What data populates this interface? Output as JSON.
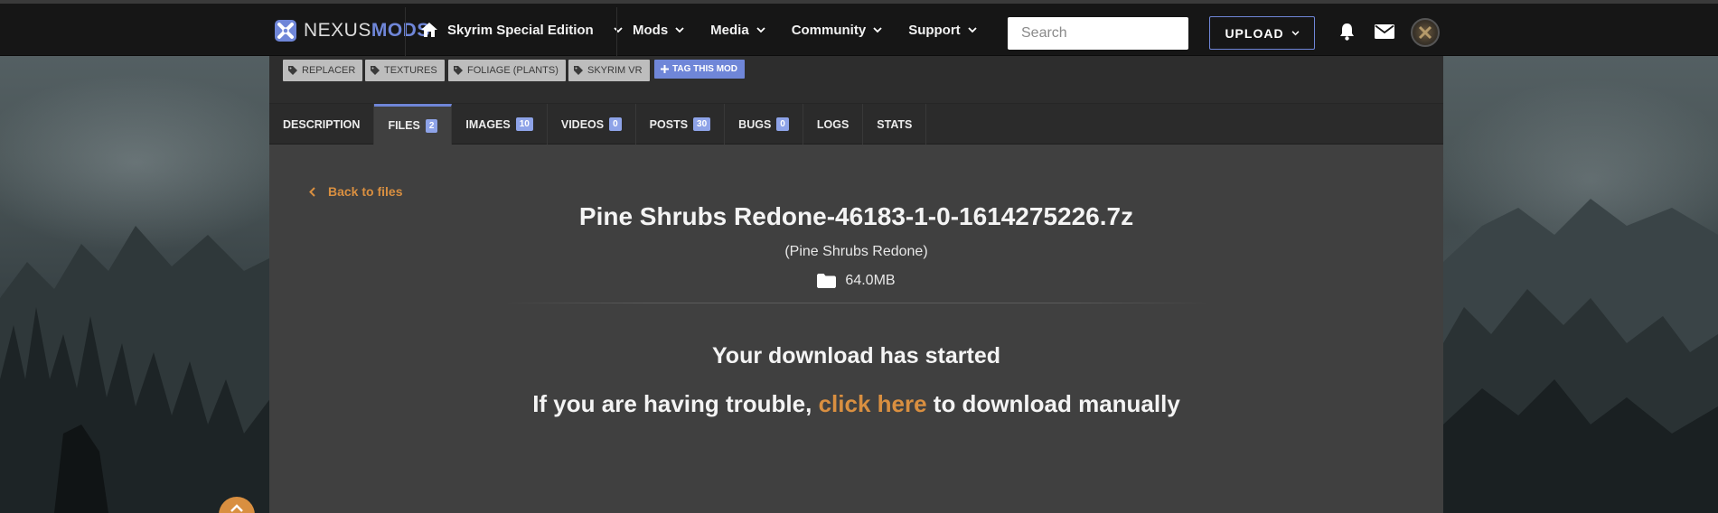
{
  "brand": {
    "logo_prefix": "NEXUS",
    "logo_suffix": "MODS"
  },
  "header": {
    "game_label": "Skyrim Special Edition",
    "menu": [
      "Mods",
      "Media",
      "Community",
      "Support"
    ],
    "search_placeholder": "Search",
    "upload_label": "UPLOAD"
  },
  "tags": [
    "REPLACER",
    "TEXTURES",
    "FOLIAGE (PLANTS)",
    "SKYRIM VR"
  ],
  "tag_this_label": "TAG THIS MOD",
  "tabs": [
    {
      "label": "DESCRIPTION",
      "count": null,
      "active": false
    },
    {
      "label": "FILES",
      "count": "2",
      "active": true
    },
    {
      "label": "IMAGES",
      "count": "10",
      "active": false
    },
    {
      "label": "VIDEOS",
      "count": "0",
      "active": false
    },
    {
      "label": "POSTS",
      "count": "30",
      "active": false
    },
    {
      "label": "BUGS",
      "count": "0",
      "active": false
    },
    {
      "label": "LOGS",
      "count": null,
      "active": false
    },
    {
      "label": "STATS",
      "count": null,
      "active": false
    }
  ],
  "download": {
    "back_label": "Back to files",
    "file_name": "Pine Shrubs Redone-46183-1-0-1614275226.7z",
    "mod_name": "(Pine Shrubs Redone)",
    "size": "64.0MB",
    "started_message": "Your download has started",
    "trouble_prefix": "If you are having trouble, ",
    "trouble_link": "click here",
    "trouble_suffix": " to download manually"
  },
  "colors": {
    "accent": "#6f86d8",
    "link": "#d98f40",
    "panel": "#404040",
    "topbar": "#161616"
  }
}
